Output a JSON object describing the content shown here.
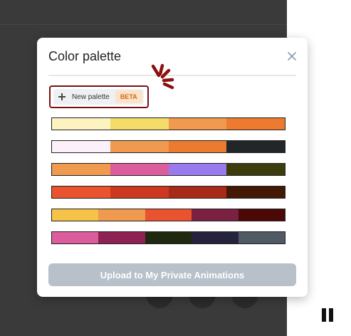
{
  "dialog": {
    "title": "Color palette",
    "close_icon": "close-icon"
  },
  "new_palette": {
    "label": "New palette",
    "badge": "BETA",
    "icon": "plus-icon",
    "highlight_color": "#7b1010"
  },
  "palettes": [
    {
      "colors": [
        "#fdf3c0",
        "#f3dd68",
        "#ef9a4f",
        "#ec7b2f"
      ]
    },
    {
      "colors": [
        "#fcf0fa",
        "#ef9a4f",
        "#ec7b2f",
        "#222629"
      ]
    },
    {
      "colors": [
        "#ef9a4f",
        "#dc5d9d",
        "#9a7bef",
        "#3b3d0c"
      ]
    },
    {
      "colors": [
        "#e9532f",
        "#cb3a20",
        "#a82a18",
        "#431804"
      ]
    },
    {
      "colors": [
        "#f4c347",
        "#ef9a4f",
        "#e9532f",
        "#7a2142",
        "#4c0707"
      ]
    },
    {
      "colors": [
        "#dc5d9d",
        "#8e2254",
        "#1f2910",
        "#25223d",
        "#4f5a64"
      ]
    }
  ],
  "upload_button": {
    "label": "Upload to My Private Animations",
    "color": "#b8c0ca"
  },
  "playback": {
    "icon": "pause-icon"
  }
}
